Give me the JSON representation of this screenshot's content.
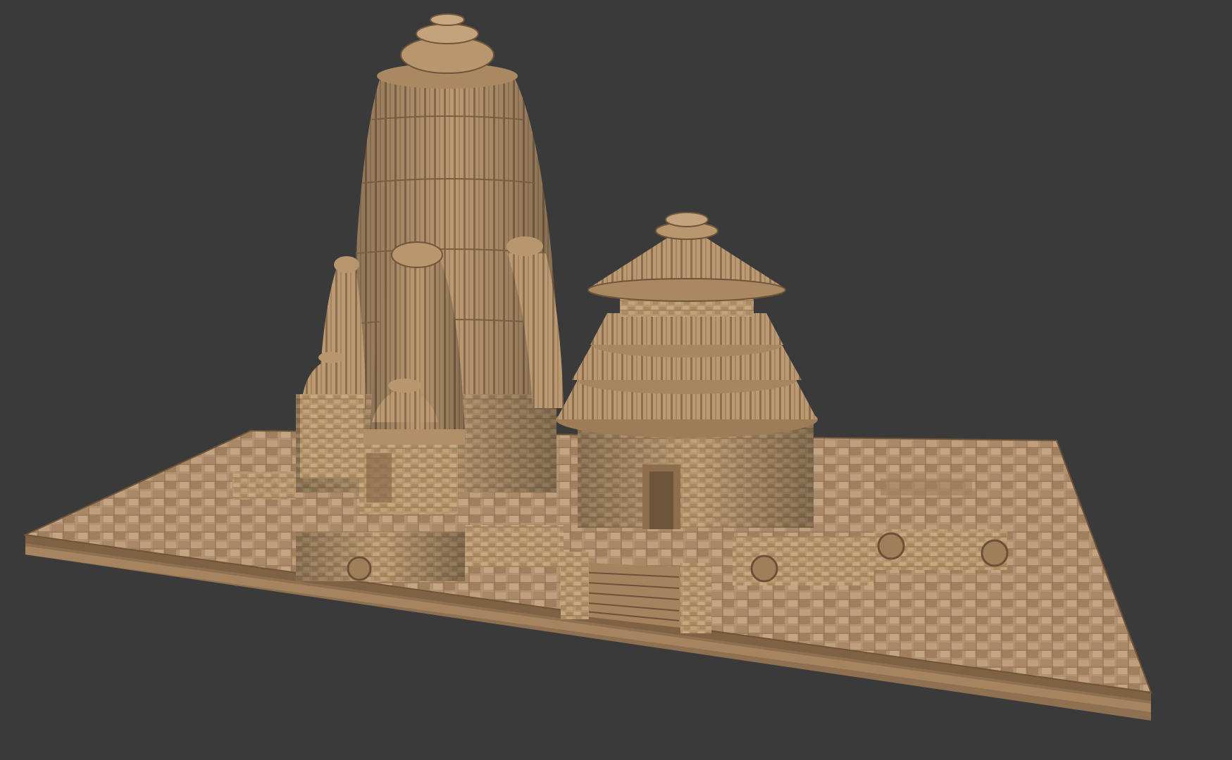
{
  "scene": {
    "subject": "temple-3d-model-render",
    "background_color": "#3a3a3a",
    "colors": {
      "stone_light": "#c9ad85",
      "stone_mid": "#b0916a",
      "stone_dark": "#7d6446",
      "stone_shadow": "#5a4631",
      "platform_top": "#b39272",
      "platform_edge": "#9c7c58"
    }
  }
}
